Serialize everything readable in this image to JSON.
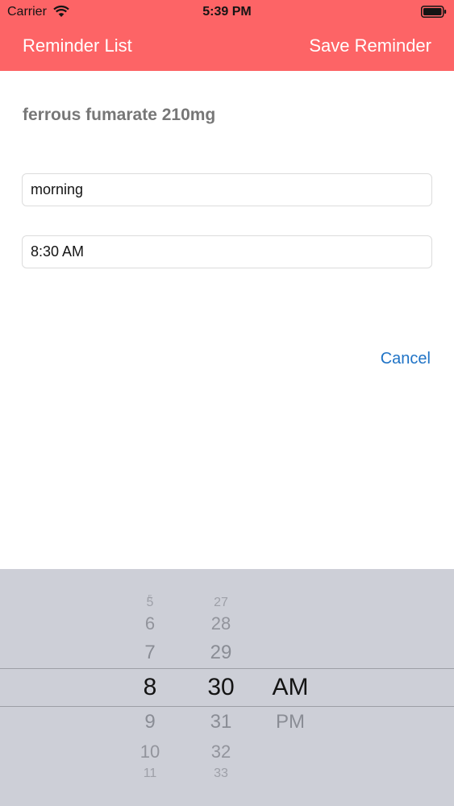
{
  "status_bar": {
    "carrier": "Carrier",
    "time": "5:39 PM"
  },
  "nav": {
    "back_label": "Reminder List",
    "save_label": "Save Reminder"
  },
  "medication": {
    "name": "ferrous fumarate 210mg"
  },
  "form": {
    "label_value": "morning",
    "time_value": "8:30 AM"
  },
  "actions": {
    "cancel_label": "Cancel"
  },
  "picker": {
    "hours": [
      "5",
      "6",
      "7",
      "8",
      "9",
      "10",
      "11"
    ],
    "minutes": [
      "27",
      "28",
      "29",
      "30",
      "31",
      "32",
      "33"
    ],
    "periods": [
      "AM",
      "PM"
    ],
    "selected": {
      "hour": "8",
      "minute": "30",
      "period": "AM"
    }
  },
  "colors": {
    "accent": "#fd6466",
    "link": "#1f73c6",
    "picker_bg": "#cdcfd7"
  }
}
